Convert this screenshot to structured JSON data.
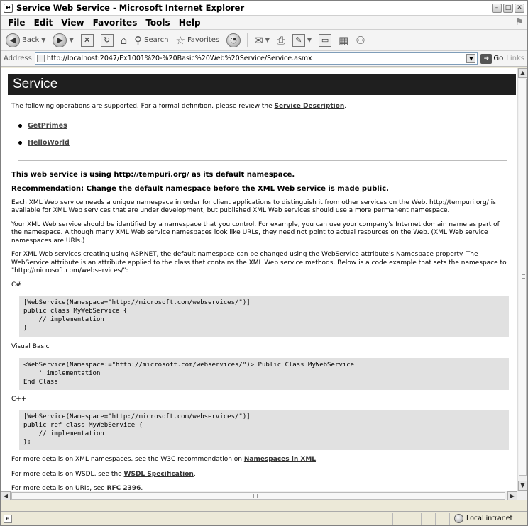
{
  "window": {
    "title": "Service Web Service - Microsoft Internet Explorer",
    "app_icon": "e",
    "controls": [
      "minimize-icon",
      "maximize-icon",
      "close-icon"
    ]
  },
  "menu": [
    "File",
    "Edit",
    "View",
    "Favorites",
    "Tools",
    "Help"
  ],
  "toolbar": {
    "back_label": "Back",
    "search_label": "Search",
    "favorites_label": "Favorites"
  },
  "address": {
    "label": "Address",
    "url": "http://localhost:2047/Ex1001%20-%20Basic%20Web%20Service/Service.asmx",
    "go_label": "Go",
    "links_label": "Links"
  },
  "page": {
    "heading": "Service",
    "intro_text": "The following operations are supported. For a formal definition, please review the ",
    "intro_link": "Service Description",
    "intro_end": ".",
    "operations": [
      "GetPrimes",
      "HelloWorld"
    ],
    "namespace_heading": "This web service is using http://tempuri.org/ as its default namespace.",
    "recommendation_heading": "Recommendation: Change the default namespace before the XML Web service is made public.",
    "para1": "Each XML Web service needs a unique namespace in order for client applications to distinguish it from other services on the Web. http://tempuri.org/ is available for XML Web services that are under development, but published XML Web services should use a more permanent namespace.",
    "para2": "Your XML Web service should be identified by a namespace that you control. For example, you can use your company's Internet domain name as part of the namespace. Although many XML Web service namespaces look like URLs, they need not point to actual resources on the Web. (XML Web service namespaces are URIs.)",
    "para3": "For XML Web services creating using ASP.NET, the default namespace can be changed using the WebService attribute's Namespace property. The WebService attribute is an attribute applied to the class that contains the XML Web service methods. Below is a code example that sets the namespace to \"http://microsoft.com/webservices/\":",
    "code_blocks": [
      {
        "language": "C#",
        "code": "[WebService(Namespace=\"http://microsoft.com/webservices/\")]\npublic class MyWebService {\n    // implementation\n}"
      },
      {
        "language": "Visual Basic",
        "code": "<WebService(Namespace:=\"http://microsoft.com/webservices/\")> Public Class MyWebService\n    ' implementation\nEnd Class"
      },
      {
        "language": "C++",
        "code": "[WebService(Namespace=\"http://microsoft.com/webservices/\")]\npublic ref class MyWebService {\n    // implementation\n};"
      }
    ],
    "more_details": [
      {
        "text": "For more details on XML namespaces, see the W3C recommendation on ",
        "link": "Namespaces in XML",
        "end": "."
      },
      {
        "text": "For more details on WSDL, see the ",
        "link": "WSDL Specification",
        "end": "."
      },
      {
        "text": "For more details on URIs, see ",
        "link": "RFC 2396",
        "end": "."
      }
    ]
  },
  "status": {
    "text": "",
    "zone": "Local intranet"
  }
}
